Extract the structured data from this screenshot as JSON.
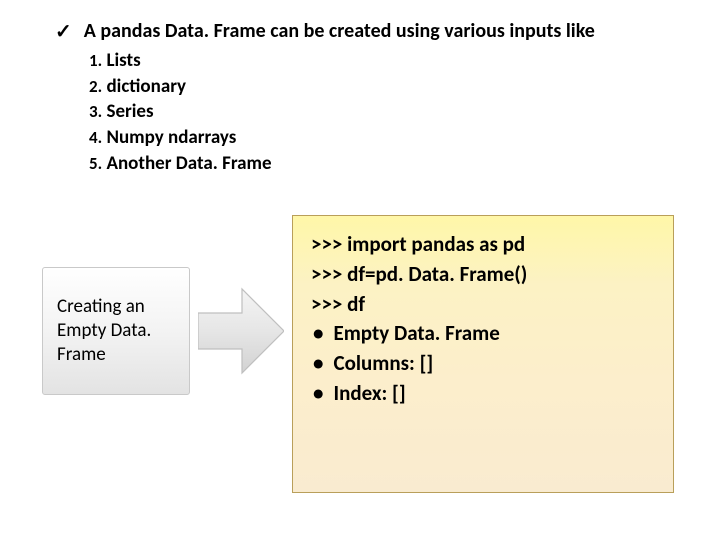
{
  "top": {
    "intro": "A pandas Data. Frame can be created using various inputs like",
    "items": [
      {
        "num": "1.",
        "label": "Lists"
      },
      {
        "num": "2.",
        "label": "dictionary"
      },
      {
        "num": "3.",
        "label": "Series"
      },
      {
        "num": "4.",
        "label": "Numpy ndarrays"
      },
      {
        "num": "5.",
        "label": "Another Data. Frame"
      }
    ]
  },
  "leftbox": {
    "text": "Creating an Empty Data. Frame"
  },
  "code": {
    "lines": [
      ">>> import pandas as pd",
      ">>> df=pd. Data. Frame()",
      ">>> df"
    ],
    "bullets": [
      "Empty Data. Frame",
      "Columns: []",
      "Index: []"
    ]
  }
}
